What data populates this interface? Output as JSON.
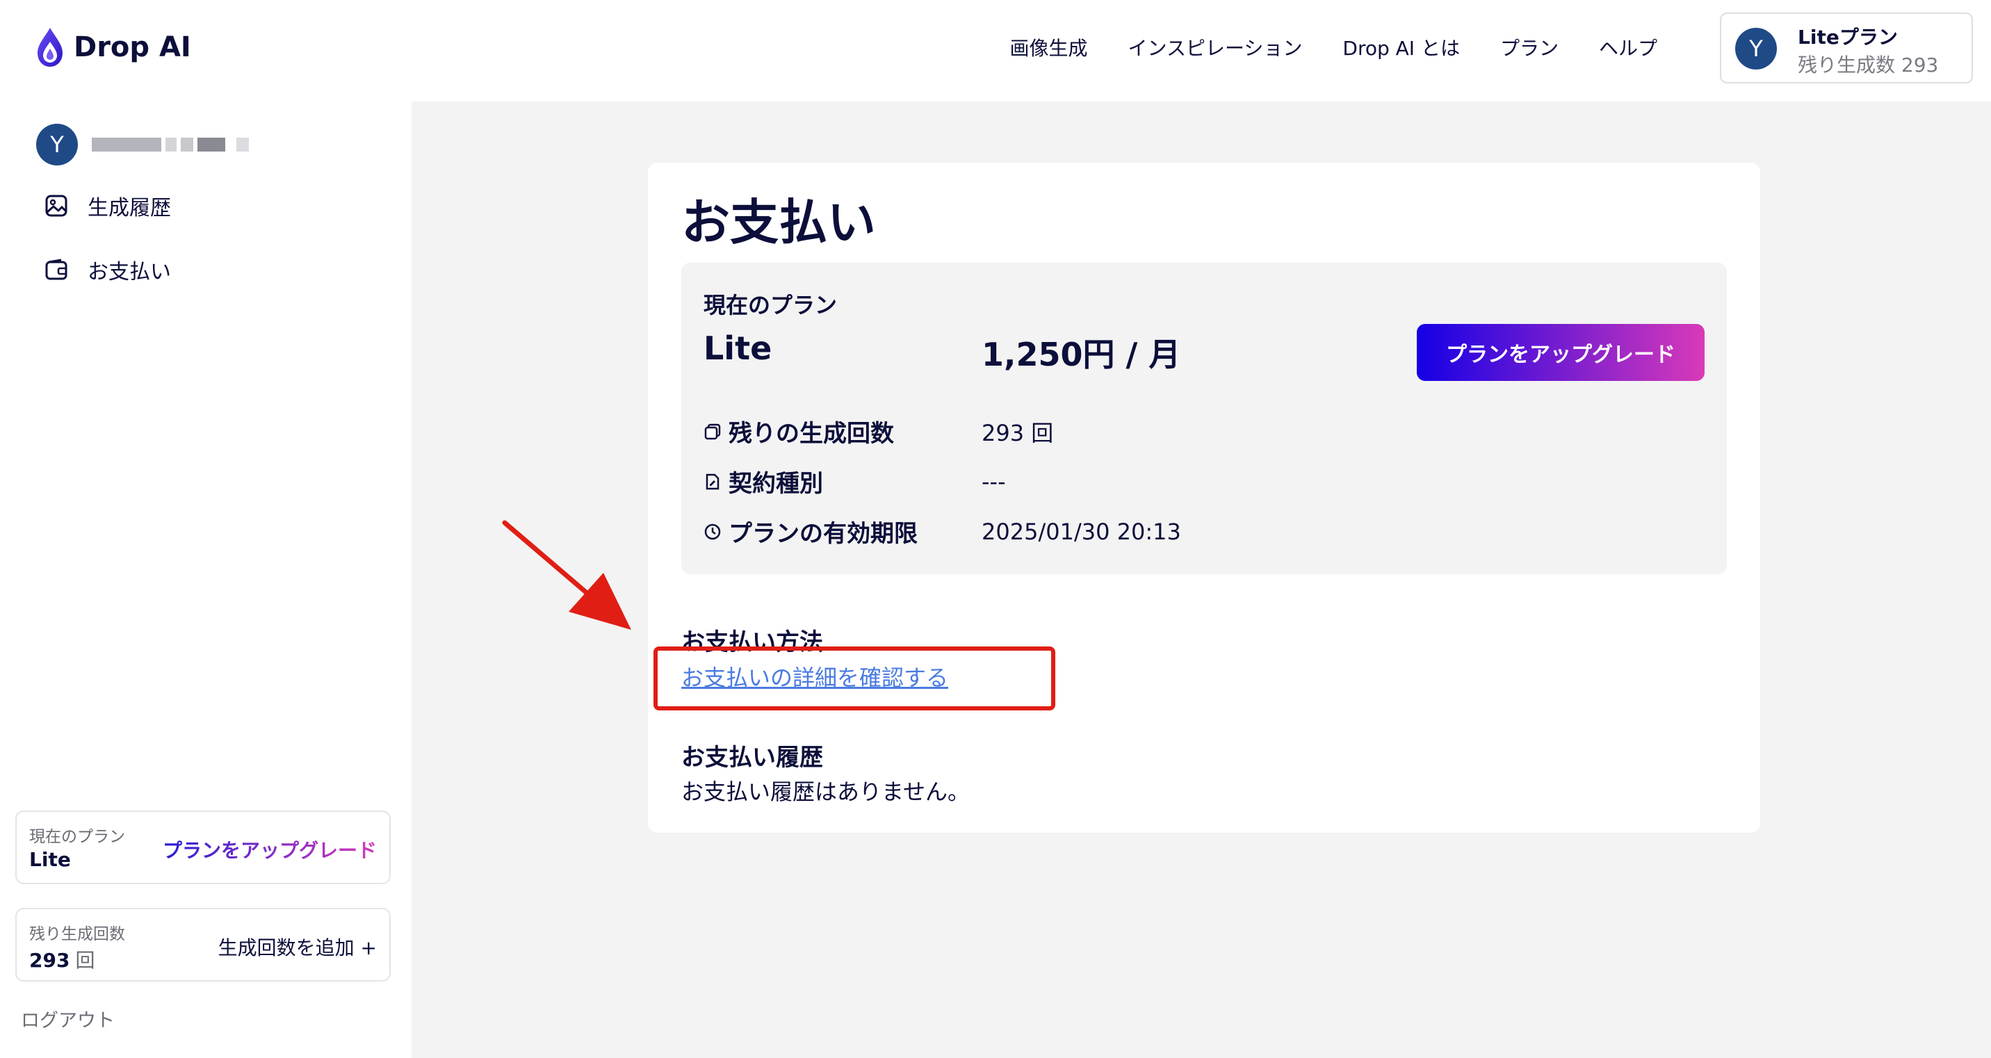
{
  "header": {
    "logo_text": "Drop AI",
    "nav": [
      "画像生成",
      "インスピレーション",
      "Drop AI とは",
      "プラン",
      "ヘルプ"
    ],
    "plan_chip": {
      "avatar": "Y",
      "title": "Liteプラン",
      "subtitle": "残り生成数  293"
    }
  },
  "sidebar": {
    "user_avatar": "Y",
    "items": [
      {
        "label": "生成履歴",
        "icon": "image-icon"
      },
      {
        "label": "お支払い",
        "icon": "wallet-icon"
      }
    ],
    "plan_box": {
      "label": "現在のプラン",
      "value": "Lite",
      "action": "プランをアップグレード"
    },
    "credits_box": {
      "label": "残り生成回数",
      "value": "293",
      "unit": "回",
      "action": "生成回数を追加 +"
    },
    "logout": "ログアウト"
  },
  "main": {
    "title": "お支払い",
    "plan_panel": {
      "label": "現在のプラン",
      "plan_name": "Lite",
      "price": "1,250円 / 月",
      "upgrade_button": "プランをアップグレード",
      "rows": [
        {
          "label": "残りの生成回数",
          "value": "293 回",
          "icon": "copy-icon"
        },
        {
          "label": "契約種別",
          "value": "---",
          "icon": "document-icon"
        },
        {
          "label": "プランの有効期限",
          "value": "2025/01/30 20:13",
          "icon": "clock-icon"
        }
      ]
    },
    "payment_method": {
      "title": "お支払い方法",
      "link": "お支払いの詳細を確認する"
    },
    "payment_history": {
      "title": "お支払い履歴",
      "empty": "お支払い履歴はありません。"
    }
  },
  "colors": {
    "accent_gradient_start": "#1400e6",
    "accent_gradient_end": "#d93ab8",
    "link": "#4a7be0",
    "annotation": "#e01e14",
    "avatar_bg": "#1f4a86"
  }
}
